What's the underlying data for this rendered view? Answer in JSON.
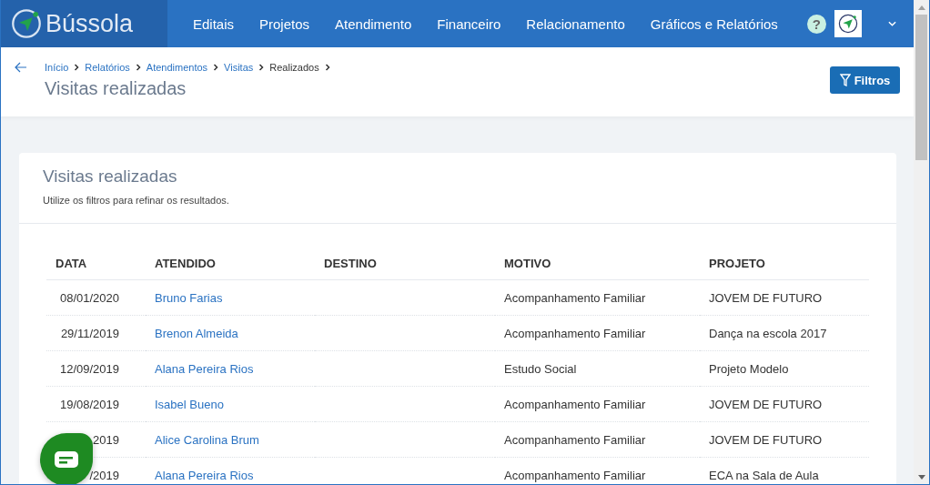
{
  "brand": {
    "name": "Bússola"
  },
  "nav": [
    "Editais",
    "Projetos",
    "Atendimento",
    "Financeiro",
    "Relacionamento",
    "Gráficos e Relatórios"
  ],
  "help": {
    "label": "?"
  },
  "breadcrumb": [
    {
      "label": "Início",
      "current": false
    },
    {
      "label": "Relatórios",
      "current": false
    },
    {
      "label": "Atendimentos",
      "current": false
    },
    {
      "label": "Visitas",
      "current": false
    },
    {
      "label": "Realizados",
      "current": true
    }
  ],
  "page_title": "Visitas realizadas",
  "filter_button": "Filtros",
  "card": {
    "title": "Visitas realizadas",
    "subtitle": "Utilize os filtros para refinar os resultados."
  },
  "table": {
    "columns": [
      "DATA",
      "ATENDIDO",
      "DESTINO",
      "MOTIVO",
      "PROJETO"
    ],
    "rows": [
      {
        "data": "08/01/2020",
        "atendido": "Bruno Farias",
        "motivo": "Acompanhamento Familiar",
        "projeto": "JOVEM DE FUTURO"
      },
      {
        "data": "29/11/2019",
        "atendido": "Brenon Almeida",
        "motivo": "Acompanhamento Familiar",
        "projeto": "Dança na escola 2017"
      },
      {
        "data": "12/09/2019",
        "atendido": "Alana Pereira Rios",
        "motivo": "Estudo Social",
        "projeto": "Projeto Modelo"
      },
      {
        "data": "19/08/2019",
        "atendido": "Isabel Bueno",
        "motivo": "Acompanhamento Familiar",
        "projeto": "JOVEM DE FUTURO"
      },
      {
        "data": "2019",
        "atendido": "Alice Carolina Brum",
        "motivo": "Acompanhamento Familiar",
        "projeto": "JOVEM DE FUTURO"
      },
      {
        "data": "/2019",
        "atendido": "Alana Pereira Rios",
        "motivo": "Acompanhamento Familiar",
        "projeto": "ECA na Sala de Aula"
      }
    ]
  }
}
